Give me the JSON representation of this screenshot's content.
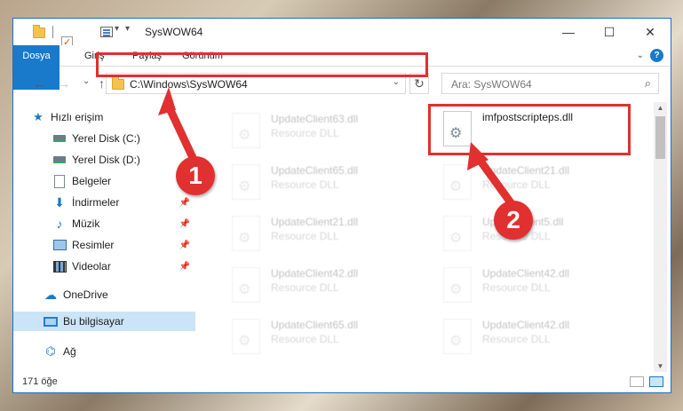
{
  "window": {
    "title": "SysWOW64",
    "minimize": "—",
    "maximize": "☐",
    "close": "✕"
  },
  "ribbon": {
    "tabs": [
      "Dosya",
      "Giriş",
      "Paylaş",
      "Görünüm"
    ],
    "help": "?"
  },
  "nav": {
    "back": "←",
    "forward": "→",
    "recent": "⌄",
    "up": "↑",
    "address": "C:\\Windows\\SysWOW64",
    "address_dropdown": "⌄",
    "refresh": "↻",
    "search_placeholder": "Ara: SysWOW64",
    "search_icon": "⌕"
  },
  "sidebar": {
    "items": [
      {
        "label": "Hızlı erişim",
        "icon": "star-icon"
      },
      {
        "label": "Yerel Disk (C:)",
        "icon": "disk-icon"
      },
      {
        "label": "Yerel Disk (D:)",
        "icon": "disk-icon"
      },
      {
        "label": "Belgeler",
        "icon": "document-icon"
      },
      {
        "label": "İndirmeler",
        "icon": "download-icon"
      },
      {
        "label": "Müzik",
        "icon": "music-icon"
      },
      {
        "label": "Resimler",
        "icon": "pictures-icon"
      },
      {
        "label": "Videolar",
        "icon": "videos-icon"
      },
      {
        "label": "OneDrive",
        "icon": "cloud-icon"
      },
      {
        "label": "Bu bilgisayar",
        "icon": "computer-icon"
      },
      {
        "label": "Ağ",
        "icon": "network-icon"
      }
    ]
  },
  "files": {
    "left": [
      {
        "name": "UpdateClient63.dll",
        "type": "Resource DLL"
      },
      {
        "name": "UpdateClient65.dll",
        "type": "Resource DLL"
      },
      {
        "name": "UpdateClient21.dll",
        "type": "Resource DLL"
      },
      {
        "name": "UpdateClient42.dll",
        "type": "Resource DLL"
      },
      {
        "name": "UpdateClient65.dll",
        "type": "Resource DLL"
      }
    ],
    "right": [
      {
        "name": "imfpostscripteps.dll",
        "type": ""
      },
      {
        "name": "UpdateClient21.dll",
        "type": "Resource DLL"
      },
      {
        "name": "UpdateClient5.dll",
        "type": "Resource DLL"
      },
      {
        "name": "UpdateClient42.dll",
        "type": "Resource DLL"
      },
      {
        "name": "UpdateClient42.dll",
        "type": "Resource DLL"
      }
    ]
  },
  "status": {
    "item_count": "171 öğe"
  },
  "callouts": {
    "step1": "1",
    "step2": "2",
    "color": "#e0302f"
  }
}
